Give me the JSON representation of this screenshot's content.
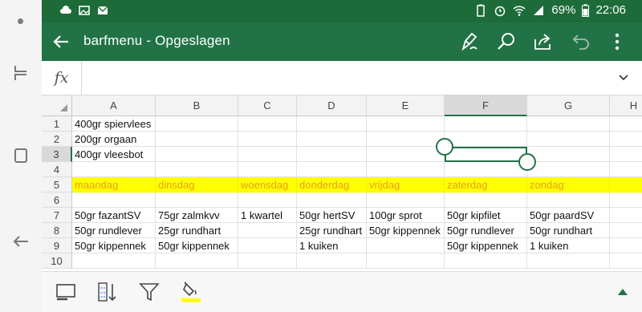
{
  "status_bar": {
    "battery": "69%",
    "time": "22:06"
  },
  "app_bar": {
    "title": "barfmenu - Opgeslagen",
    "icons": [
      "back-arrow-icon",
      "draw-pen-icon",
      "search-icon",
      "share-icon",
      "undo-icon",
      "more-vert-icon"
    ]
  },
  "formula_bar": {
    "fx_label": "fx",
    "value": ""
  },
  "grid": {
    "columns": [
      "A",
      "B",
      "C",
      "D",
      "E",
      "F",
      "G",
      "H"
    ],
    "selected_column": "F",
    "rows": [
      "1",
      "2",
      "3",
      "4",
      "5",
      "6",
      "7",
      "8",
      "9",
      "10"
    ],
    "selected_row": "3",
    "cells": {
      "A1": "400gr spiervlees",
      "A2": "200gr orgaan",
      "A3": "400gr vleesbot",
      "A5": "maandag",
      "B5": "dinsdag",
      "C5": "woensdag",
      "D5": "donderdag",
      "E5": "vrijdag",
      "F5": "zaterdag",
      "G5": "zondag",
      "A7": "50gr fazantSV",
      "B7": "75gr zalmkvv",
      "C7": "1 kwartel",
      "D7": "50gr hertSV",
      "E7": "100gr sprot",
      "F7": "50gr kipfilet",
      "G7": "50gr paardSV",
      "A8": "50gr rundlever",
      "B8": "25gr rundhart",
      "D8": "25gr rundhart",
      "E8": "50gr kippennek",
      "F8": "50gr rundlever",
      "G8": "50gr rundhart",
      "A9": "50gr kippennek",
      "B9": "50gr kippennek",
      "D9": "1 kuiken",
      "F9": "50gr kippennek",
      "G9": "1 kuiken"
    },
    "highlight_row": "5",
    "highlight_fill": "#ffff00",
    "highlight_text_color": "#e8a11b"
  },
  "toolbar": {
    "icons": [
      "card-view-icon",
      "sort-icon",
      "filter-icon",
      "fill-color-icon"
    ],
    "fill_color": "#ffff00",
    "expand": "expand-toolbar-icon"
  },
  "colors": {
    "accent": "#217346",
    "status_bar": "#1d6b39"
  }
}
